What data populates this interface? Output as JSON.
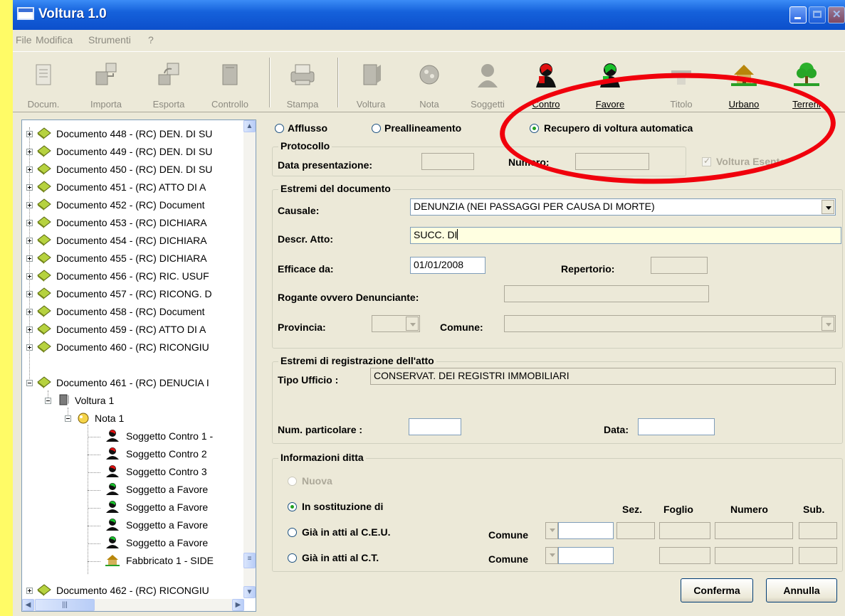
{
  "window": {
    "title": "Voltura 1.0"
  },
  "menu": [
    "File",
    "Modifica",
    "Strumenti",
    "?"
  ],
  "toolbar": [
    {
      "label": "Docum.",
      "icon": "document-icon",
      "enabled": false
    },
    {
      "label": "Importa",
      "icon": "import-icon",
      "enabled": false
    },
    {
      "label": "Esporta",
      "icon": "export-icon",
      "enabled": false
    },
    {
      "label": "Controllo",
      "icon": "check-icon",
      "enabled": false
    },
    {
      "label": "Stampa",
      "icon": "printer-icon",
      "enabled": false
    },
    {
      "label": "Voltura",
      "icon": "voltura-icon",
      "enabled": false
    },
    {
      "label": "Nota",
      "icon": "note-icon",
      "enabled": false
    },
    {
      "label": "Soggetti",
      "icon": "subjects-icon",
      "enabled": false
    },
    {
      "label": "Contro",
      "icon": "person-red-icon",
      "enabled": true
    },
    {
      "label": "Favore",
      "icon": "person-green-icon",
      "enabled": true
    },
    {
      "label": "Titolo",
      "icon": "title-icon",
      "enabled": false
    },
    {
      "label": "Urbano",
      "icon": "house-icon",
      "enabled": true
    },
    {
      "label": "Terreni",
      "icon": "tree-icon",
      "enabled": true
    }
  ],
  "tree": [
    "Documento 448 - (RC) DEN. DI SU",
    "Documento 449 - (RC) DEN. DI SU",
    "Documento 450 - (RC) DEN. DI SU",
    "Documento 451 - (RC) ATTO DI A",
    "Documento 452 - (RC) Document",
    "Documento 453 - (RC) DICHIARA",
    "Documento 454 - (RC) DICHIARA",
    "Documento 455 - (RC) DICHIARA",
    "Documento 456 - (RC) RIC. USUF",
    "Documento 457 - (RC) RICONG. D",
    "Documento 458 - (RC) Document",
    "Documento 459 - (RC) ATTO DI A",
    "Documento 460 - (RC) RICONGIU",
    "Documento 461 - (RC) DENUCIA I",
    "Voltura  1",
    "Nota  1",
    "Soggetto Contro  1 -",
    "Soggetto Contro  2",
    "Soggetto Contro  3",
    "Soggetto a Favore",
    "Soggetto a Favore",
    "Soggetto a Favore",
    "Soggetto a Favore",
    "Fabbricato  1 - SIDE",
    "Documento 462 - (RC) RICONGIU"
  ],
  "mode": {
    "afflusso": "Afflusso",
    "preallineamento": "Preallineamento",
    "recupero": "Recupero di voltura automatica",
    "selected": "recupero"
  },
  "protocollo": {
    "title": "Protocollo",
    "data_label": "Data presentazione:",
    "numero_label": "Numero:",
    "voltura_esente": "Voltura Esente"
  },
  "documento": {
    "title": "Estremi del documento",
    "causale_label": "Causale:",
    "causale_value": "DENUNZIA (NEI PASSAGGI PER CAUSA DI MORTE)",
    "descr_label": "Descr. Atto:",
    "descr_value": "SUCC. DI",
    "efficace_label": "Efficace da:",
    "efficace_value": "01/01/2008",
    "repertorio_label": "Repertorio:",
    "rogante_label": "Rogante ovvero Denunciante:",
    "provincia_label": "Provincia:",
    "comune_label": "Comune:"
  },
  "registrazione": {
    "title": "Estremi di registrazione dell'atto",
    "tipo_label": "Tipo Ufficio :",
    "tipo_value": "CONSERVAT. DEI REGISTRI IMMOBILIARI",
    "num_label": "Num. particolare :",
    "data_label": "Data:"
  },
  "ditta": {
    "title": "Informazioni ditta",
    "nuova": "Nuova",
    "sostituzione": "In sostituzione di",
    "ceu": "Già in atti al C.E.U.",
    "ct": "Già in atti al C.T.",
    "comune_label": "Comune",
    "cols": [
      "Sez.",
      "Foglio",
      "Numero",
      "Sub."
    ]
  },
  "buttons": {
    "conferma": "Conferma",
    "annulla": "Annulla"
  },
  "colors": {
    "annotation": "#f0000c",
    "background": "#fffb66"
  }
}
